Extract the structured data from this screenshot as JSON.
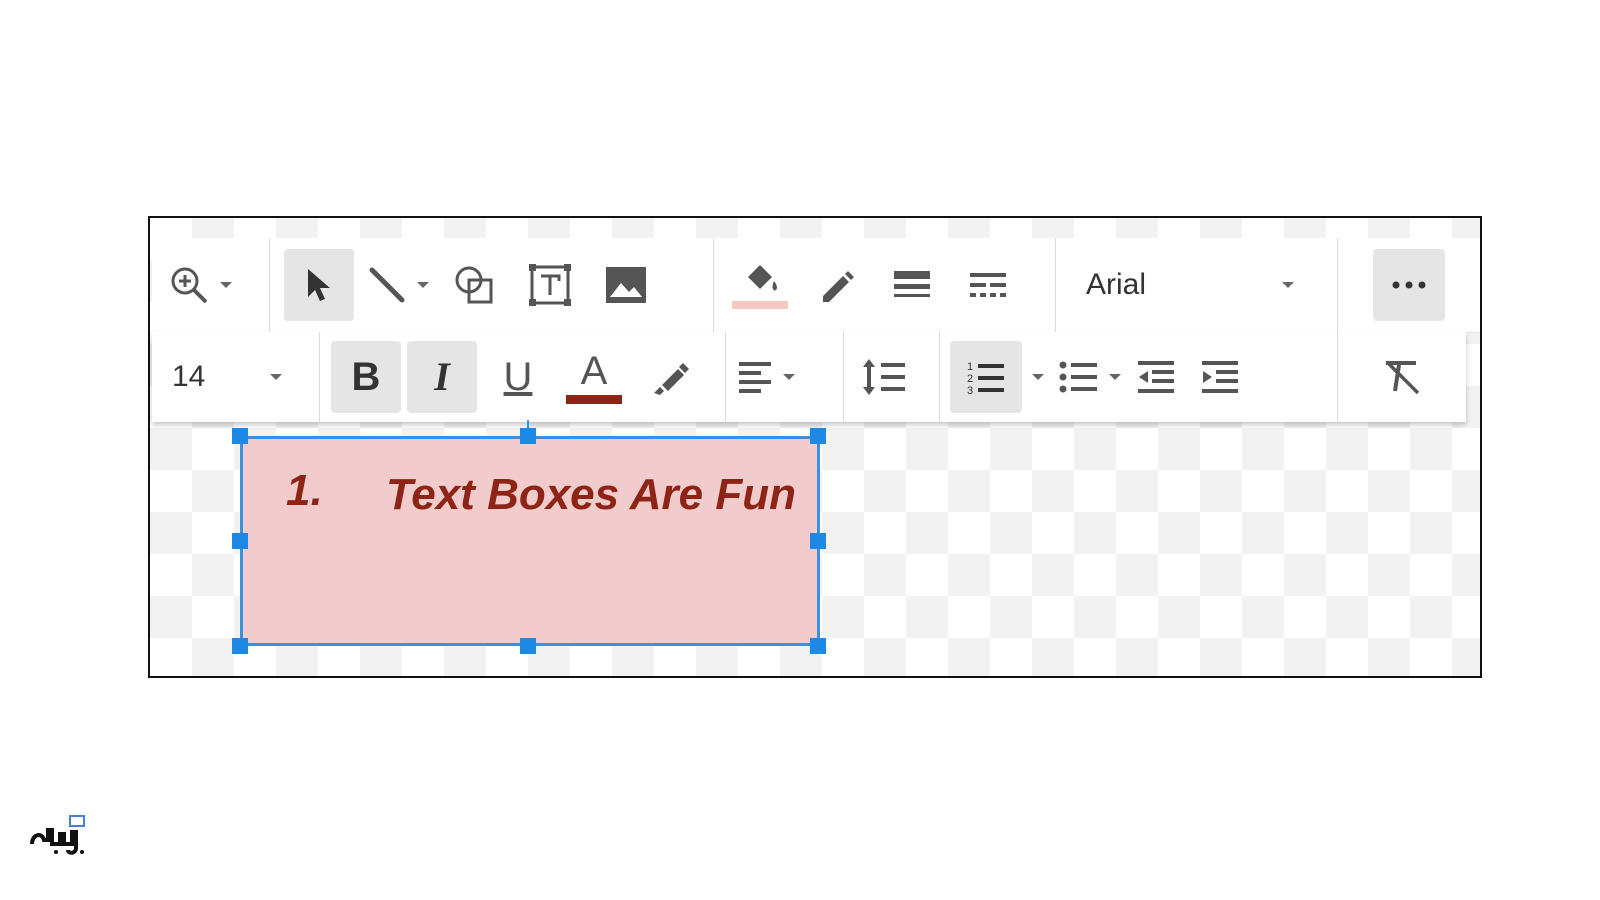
{
  "toolbar_row1": {
    "zoom_icon": "zoom-in-icon",
    "select_icon": "cursor-arrow-icon",
    "line_icon": "line-icon",
    "shape_icon": "shape-icon",
    "textbox_icon": "text-box-icon",
    "image_icon": "image-icon",
    "fill_color_icon": "paint-bucket-icon",
    "fill_color": "#f4c7c3",
    "border_color_icon": "pencil-icon",
    "border_weight_icon": "border-weight-icon",
    "border_dash_icon": "border-dash-icon",
    "font_name": "Arial",
    "more_icon": "more-horizontal-icon"
  },
  "toolbar_row2": {
    "font_size": "14",
    "bold_label": "B",
    "italic_label": "I",
    "underline_label": "U",
    "text_color_label": "A",
    "text_color": "#8e2416",
    "highlight_icon": "highlighter-icon",
    "align_icon": "align-left-icon",
    "line_spacing_icon": "line-spacing-icon",
    "numbered_list_icon": "numbered-list-icon",
    "bulleted_list_icon": "bulleted-list-icon",
    "decrease_indent_icon": "decrease-indent-icon",
    "increase_indent_icon": "increase-indent-icon",
    "clear_format_icon": "clear-formatting-icon"
  },
  "textbox": {
    "number": "1.",
    "text": "Text Boxes Are Fun",
    "fill": "#f2cccc",
    "text_color": "#8e2416",
    "border_color": "#3d8fe0"
  },
  "colors": {
    "selection_handle": "#1e88e5",
    "active_button_bg": "#e5e5e5"
  }
}
